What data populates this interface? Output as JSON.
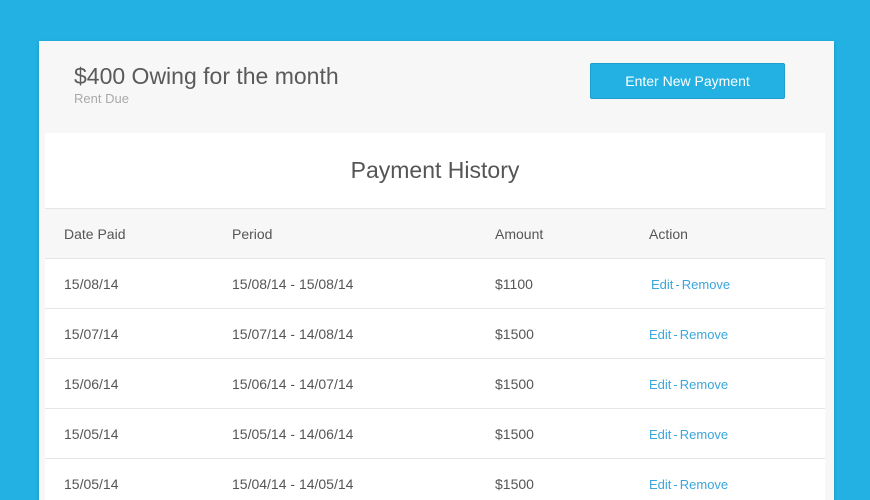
{
  "header": {
    "owing_title": "$400 Owing for the month",
    "owing_subtitle": "Rent Due",
    "enter_button_label": "Enter New Payment"
  },
  "history": {
    "title": "Payment History",
    "columns": [
      "Date Paid",
      "Period",
      "Amount",
      "Action"
    ],
    "rows": [
      {
        "date": "15/08/14",
        "period": "15/08/14 - 15/08/14",
        "amount": "$1100",
        "edit": "Edit",
        "sep": "-",
        "remove": "Remove"
      },
      {
        "date": "15/07/14",
        "period": "15/07/14 - 14/08/14",
        "amount": "$1500",
        "edit": "Edit",
        "sep": "-",
        "remove": "Remove"
      },
      {
        "date": "15/06/14",
        "period": "15/06/14 - 14/07/14",
        "amount": "$1500",
        "edit": "Edit",
        "sep": "-",
        "remove": "Remove"
      },
      {
        "date": "15/05/14",
        "period": "15/05/14 - 14/06/14",
        "amount": "$1500",
        "edit": "Edit",
        "sep": "-",
        "remove": "Remove"
      },
      {
        "date": "15/05/14",
        "period": "15/04/14 - 14/05/14",
        "amount": "$1500",
        "edit": "Edit",
        "sep": "-",
        "remove": "Remove"
      }
    ]
  },
  "colors": {
    "background": "#22b1e2",
    "accent": "#22b1e2",
    "link": "#3aa6dc"
  }
}
